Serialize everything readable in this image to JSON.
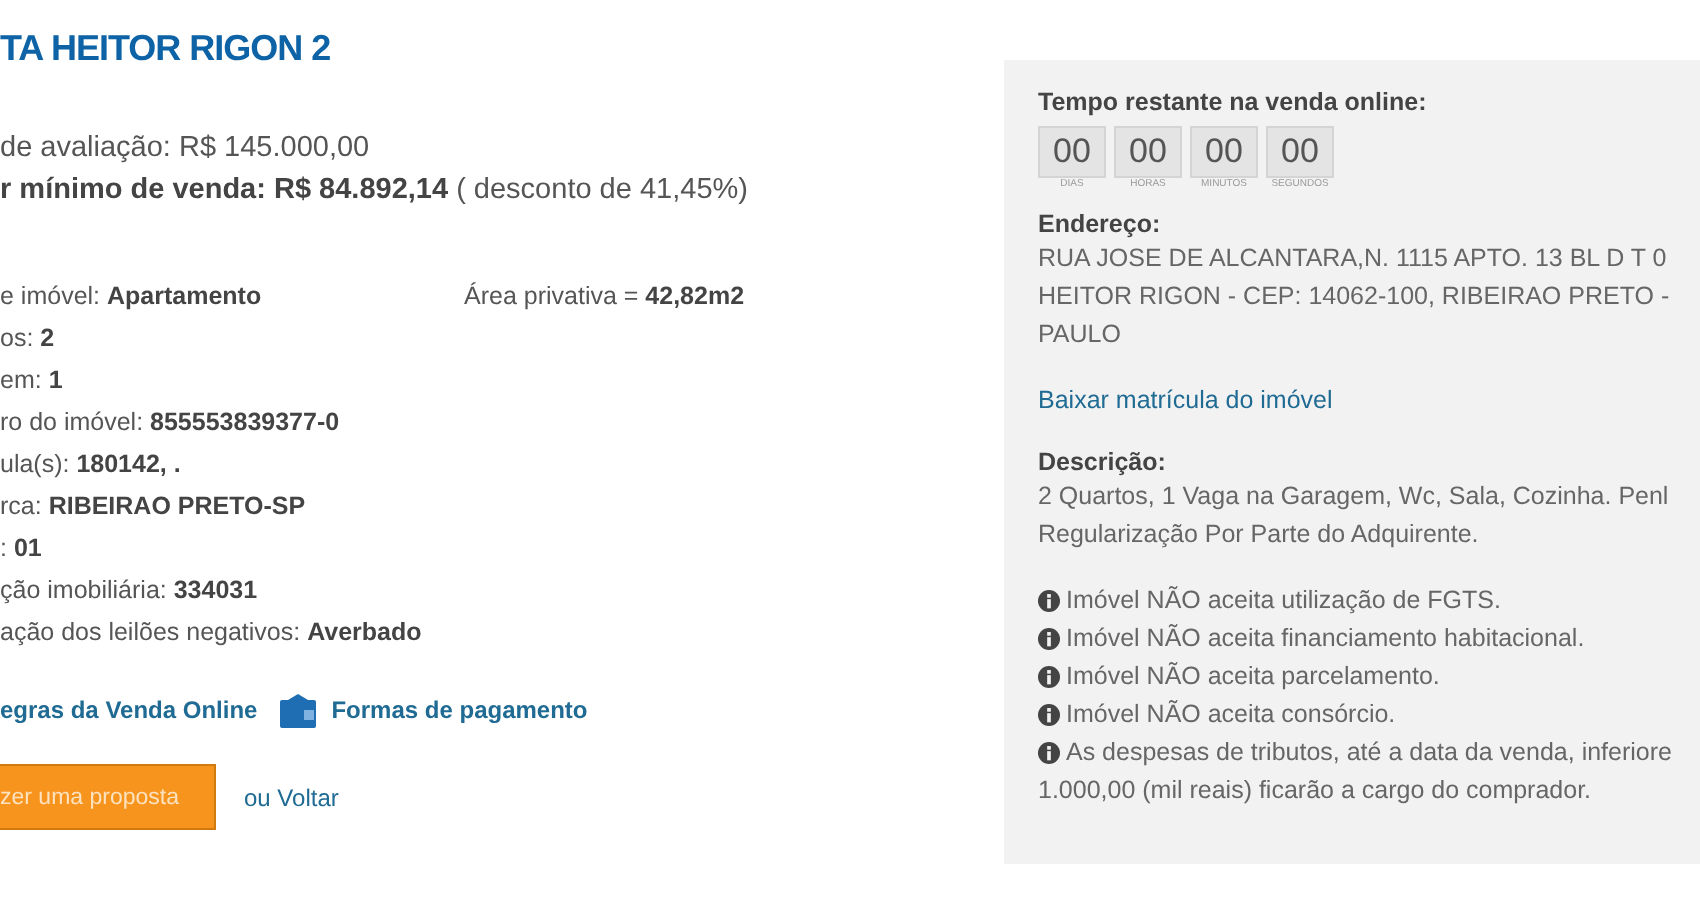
{
  "title": "TA HEITOR RIGON 2",
  "prices": [
    "de avaliação: R$ 145.000,00",
    "**r mínimo de venda: R$ 84.892,14** ( desconto de 41,45%)"
  ],
  "details": [
    {
      "text": "e imóvel: **Apartamento**",
      "side": "Área privativa = **42,82m2**"
    },
    {
      "text": "os: **2**"
    },
    {
      "text": "em: **1**"
    },
    {
      "text": "ro do imóvel: **855553839377-0**"
    },
    {
      "text": "ula(s): **180142, .**"
    },
    {
      "text": "rca: **RIBEIRAO PRETO-SP**"
    },
    {
      "text": ": **01**"
    },
    {
      "text": "ção imobiliária: **334031**"
    },
    {
      "text": "ação dos leilões negativos: **Averbado**"
    }
  ],
  "links": [
    {
      "label": "egras da Venda Online",
      "kind": "plain"
    },
    {
      "label": "Formas de pagamento",
      "kind": "wallet"
    }
  ],
  "proposal_button": "zer uma proposta",
  "back_link": "ou Voltar",
  "panel": {
    "countdown_title": "Tempo restante na venda online:",
    "countdown": [
      {
        "value": "00",
        "unit": "DIAS"
      },
      {
        "value": "00",
        "unit": "HORAS"
      },
      {
        "value": "00",
        "unit": "MINUTOS"
      },
      {
        "value": "00",
        "unit": "SEGUNDOS"
      }
    ],
    "address_title": "Endereço:",
    "address_lines": [
      "RUA JOSE DE ALCANTARA,N. 1115 APTO. 13 BL D T 0",
      "HEITOR RIGON - CEP: 14062-100, RIBEIRAO PRETO -",
      "PAULO"
    ],
    "registry_link": "Baixar matrícula do imóvel",
    "description_title": "Descrição:",
    "description_lines": [
      "2 Quartos, 1 Vaga na Garagem, Wc, Sala, Cozinha. Penl",
      "Regularização Por Parte do Adquirente."
    ],
    "notices": [
      {
        "lines": [
          "Imóvel NÃO aceita utilização de FGTS."
        ]
      },
      {
        "lines": [
          "Imóvel NÃO aceita financiamento habitacional."
        ]
      },
      {
        "lines": [
          "Imóvel NÃO aceita parcelamento."
        ]
      },
      {
        "lines": [
          "Imóvel NÃO aceita consórcio."
        ]
      },
      {
        "lines": [
          "As despesas de tributos, até a data da venda, inferiore",
          "1.000,00 (mil reais) ficarão a cargo do comprador."
        ]
      }
    ]
  }
}
